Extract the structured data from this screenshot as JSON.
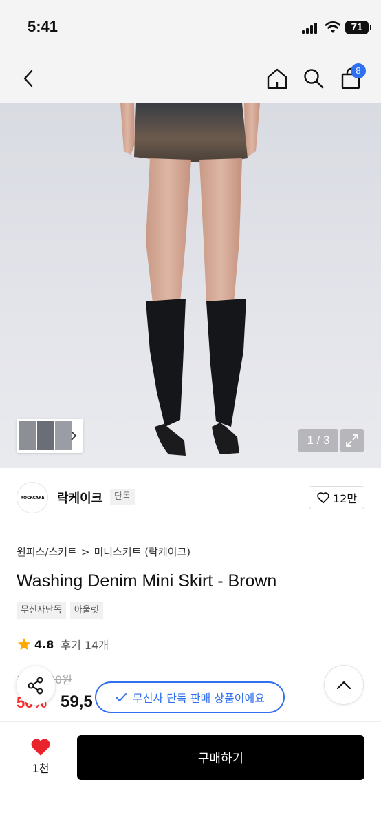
{
  "status_bar": {
    "time": "5:41",
    "battery": "71"
  },
  "nav": {
    "cart_count": "8"
  },
  "gallery": {
    "counter": "1 / 3"
  },
  "brand": {
    "logo_text": "ROCKCAKE",
    "name": "락케이크",
    "exclusive_tag": "단독",
    "like_count": "12만"
  },
  "breadcrumb": {
    "category": "원피스/스커트",
    "separator": ">",
    "subcategory": "미니스커트 (락케이크)"
  },
  "product": {
    "title": "Washing Denim Mini Skirt - Brown",
    "tags": [
      "무신사단독",
      "아울렛"
    ],
    "rating": "4.8",
    "reviews": "후기 14개",
    "original_price": "119,000원",
    "discount": "50%",
    "sale_price": "59,5"
  },
  "toast": {
    "message": "무신사 단독 판매 상품이에요"
  },
  "bottom": {
    "wish_count": "1천",
    "buy_label": "구매하기"
  },
  "colors": {
    "accent": "#2f6ff0",
    "discount": "#ff2a2a",
    "heart": "#e8232c",
    "star": "#ffa800"
  }
}
